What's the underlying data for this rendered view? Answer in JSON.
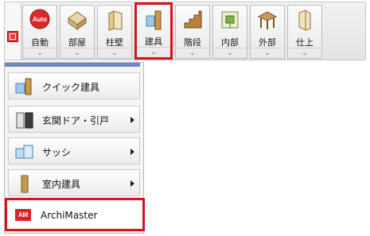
{
  "toolbar": {
    "items": [
      {
        "label": "自動",
        "icon": "auto-icon",
        "badge": "Auto"
      },
      {
        "label": "部屋",
        "icon": "room-icon"
      },
      {
        "label": "柱壁",
        "icon": "pillar-wall-icon"
      },
      {
        "label": "建具",
        "icon": "fitting-icon"
      },
      {
        "label": "階段",
        "icon": "stairs-icon"
      },
      {
        "label": "内部",
        "icon": "interior-icon"
      },
      {
        "label": "外部",
        "icon": "exterior-icon"
      },
      {
        "label": "仕上",
        "icon": "finish-icon"
      }
    ],
    "chevron": "⌄"
  },
  "menu": {
    "items": [
      {
        "label": "クイック建具",
        "icon": "quick-fitting-icon"
      },
      {
        "label": "玄関ドア・引戸",
        "icon": "entrance-door-icon"
      },
      {
        "label": "サッシ",
        "icon": "sash-icon"
      },
      {
        "label": "室内建具",
        "icon": "interior-door-icon"
      },
      {
        "label": "ArchiMaster",
        "icon": "archimaster-icon",
        "icon_text": "AM"
      }
    ]
  },
  "colors": {
    "highlight": "#d4151b",
    "menu_accent": "#6f86c4"
  }
}
